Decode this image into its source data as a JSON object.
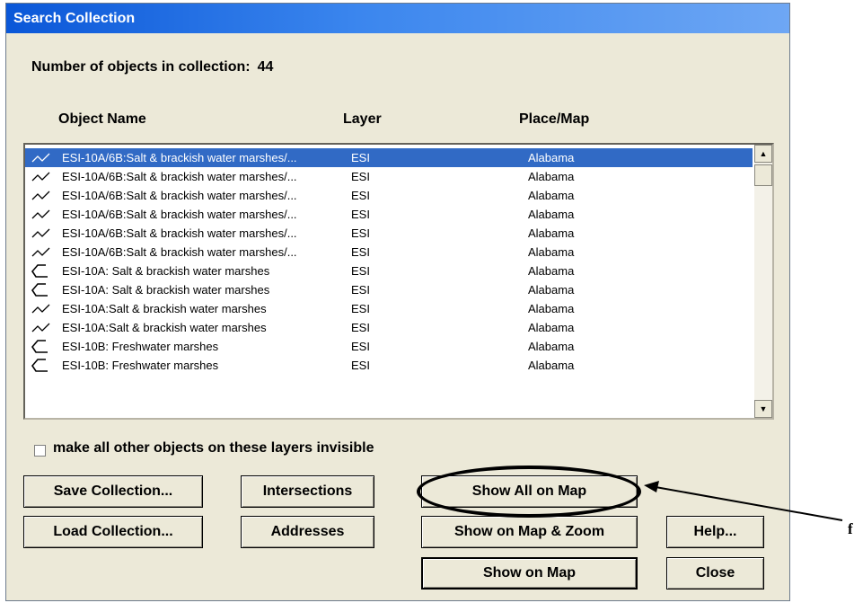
{
  "window": {
    "title": "Search Collection"
  },
  "count": {
    "label": "Number of objects in collection:",
    "value": "44"
  },
  "columns": {
    "name": "Object Name",
    "layer": "Layer",
    "place": "Place/Map"
  },
  "rows": [
    {
      "icon": "line-icon",
      "name": "ESI-10A/6B:Salt & brackish water marshes/...",
      "layer": "ESI",
      "place": "Alabama",
      "selected": true
    },
    {
      "icon": "line-icon",
      "name": "ESI-10A/6B:Salt & brackish water marshes/...",
      "layer": "ESI",
      "place": "Alabama"
    },
    {
      "icon": "line-icon",
      "name": "ESI-10A/6B:Salt & brackish water marshes/...",
      "layer": "ESI",
      "place": "Alabama"
    },
    {
      "icon": "line-icon",
      "name": "ESI-10A/6B:Salt & brackish water marshes/...",
      "layer": "ESI",
      "place": "Alabama"
    },
    {
      "icon": "line-icon",
      "name": "ESI-10A/6B:Salt & brackish water marshes/...",
      "layer": "ESI",
      "place": "Alabama"
    },
    {
      "icon": "line-icon",
      "name": "ESI-10A/6B:Salt & brackish water marshes/...",
      "layer": "ESI",
      "place": "Alabama"
    },
    {
      "icon": "polygon-icon",
      "name": "ESI-10A: Salt & brackish water marshes",
      "layer": "ESI",
      "place": "Alabama"
    },
    {
      "icon": "polygon-icon",
      "name": "ESI-10A: Salt & brackish water marshes",
      "layer": "ESI",
      "place": "Alabama"
    },
    {
      "icon": "line-icon",
      "name": "ESI-10A:Salt & brackish water marshes",
      "layer": "ESI",
      "place": "Alabama"
    },
    {
      "icon": "line-icon",
      "name": "ESI-10A:Salt & brackish water marshes",
      "layer": "ESI",
      "place": "Alabama"
    },
    {
      "icon": "polygon-icon",
      "name": "ESI-10B: Freshwater marshes",
      "layer": "ESI",
      "place": "Alabama"
    },
    {
      "icon": "polygon-icon",
      "name": "ESI-10B: Freshwater marshes",
      "layer": "ESI",
      "place": "Alabama"
    }
  ],
  "options": {
    "invisible_label": "make all other objects on these layers invisible",
    "invisible_checked": false
  },
  "buttons": {
    "save_collection": "Save Collection...",
    "intersections": "Intersections",
    "show_all_on_map": "Show All on Map",
    "load_collection": "Load Collection...",
    "addresses": "Addresses",
    "show_on_map_zoom": "Show on Map & Zoom",
    "help": "Help...",
    "show_on_map": "Show on Map",
    "close": "Close"
  },
  "annotation": {
    "text": "f"
  }
}
